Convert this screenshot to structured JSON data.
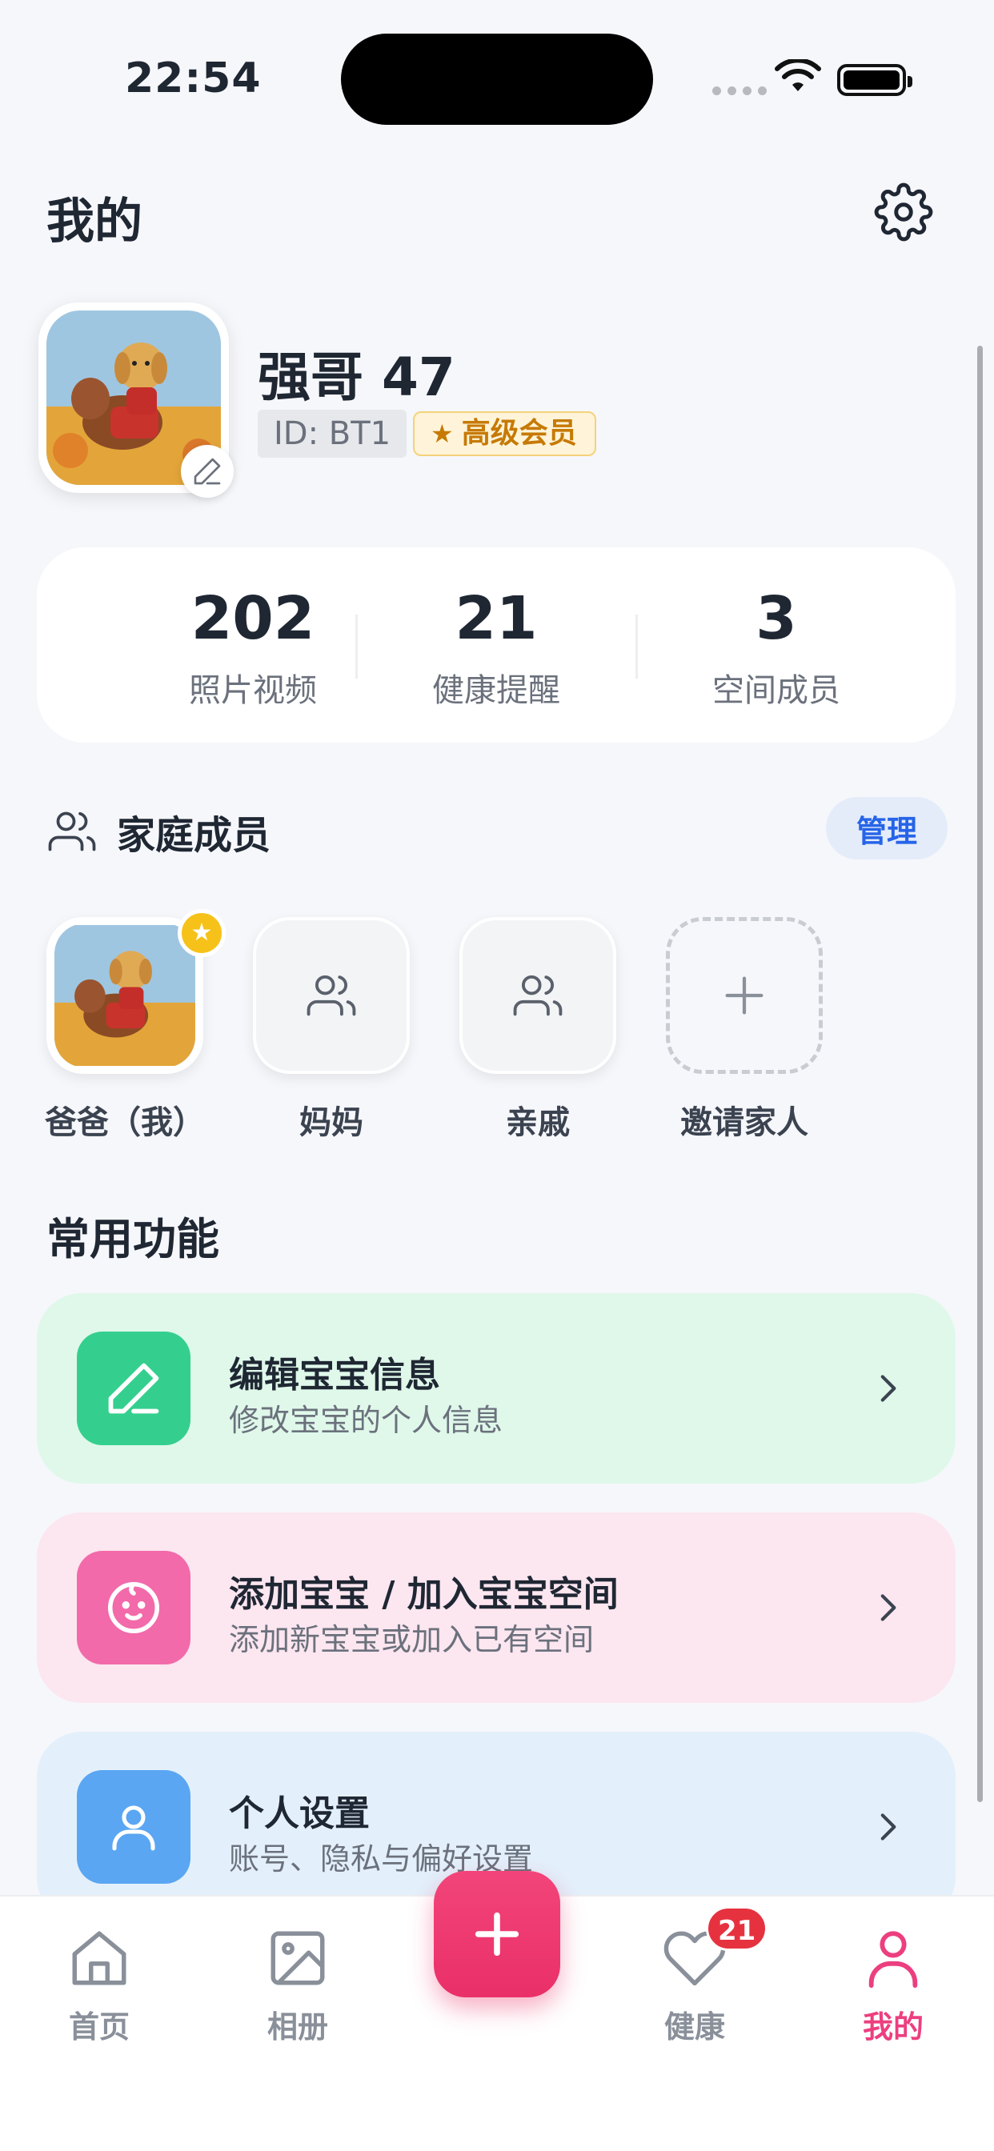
{
  "status_bar": {
    "time": "22:54"
  },
  "header": {
    "title": "我的"
  },
  "profile": {
    "name": "强哥 47",
    "id_label": "ID: BT1",
    "vip_label": "高级会员"
  },
  "stats": [
    {
      "value": "202",
      "label": "照片视频"
    },
    {
      "value": "21",
      "label": "健康提醒"
    },
    {
      "value": "3",
      "label": "空间成员"
    }
  ],
  "family": {
    "title": "家庭成员",
    "manage_label": "管理",
    "members": [
      {
        "name": "爸爸（我）",
        "icon": "avatar-photo"
      },
      {
        "name": "妈妈",
        "icon": "users-icon"
      },
      {
        "name": "亲戚",
        "icon": "users-icon"
      },
      {
        "name": "邀请家人",
        "icon": "plus-icon"
      }
    ]
  },
  "functions": {
    "title": "常用功能",
    "items": [
      {
        "title": "编辑宝宝信息",
        "subtitle": "修改宝宝的个人信息",
        "icon": "pencil-icon",
        "color": "#34cf8e",
        "bg": "#dff8ea"
      },
      {
        "title": "添加宝宝 / 加入宝宝空间",
        "subtitle": "添加新宝宝或加入已有空间",
        "icon": "baby-face-icon",
        "color": "#f26aaa",
        "bg": "#fce6f0"
      },
      {
        "title": "个人设置",
        "subtitle": "账号、隐私与偏好设置",
        "icon": "user-icon",
        "color": "#5aa6f2",
        "bg": "#e3f0fb"
      }
    ]
  },
  "tabbar": {
    "tabs": [
      {
        "label": "首页",
        "icon": "home-icon"
      },
      {
        "label": "相册",
        "icon": "image-icon"
      },
      {
        "label": "健康",
        "icon": "heart-icon",
        "badge": "21"
      },
      {
        "label": "我的",
        "icon": "person-icon",
        "active": true
      }
    ],
    "accent": "#ec3f7f"
  }
}
